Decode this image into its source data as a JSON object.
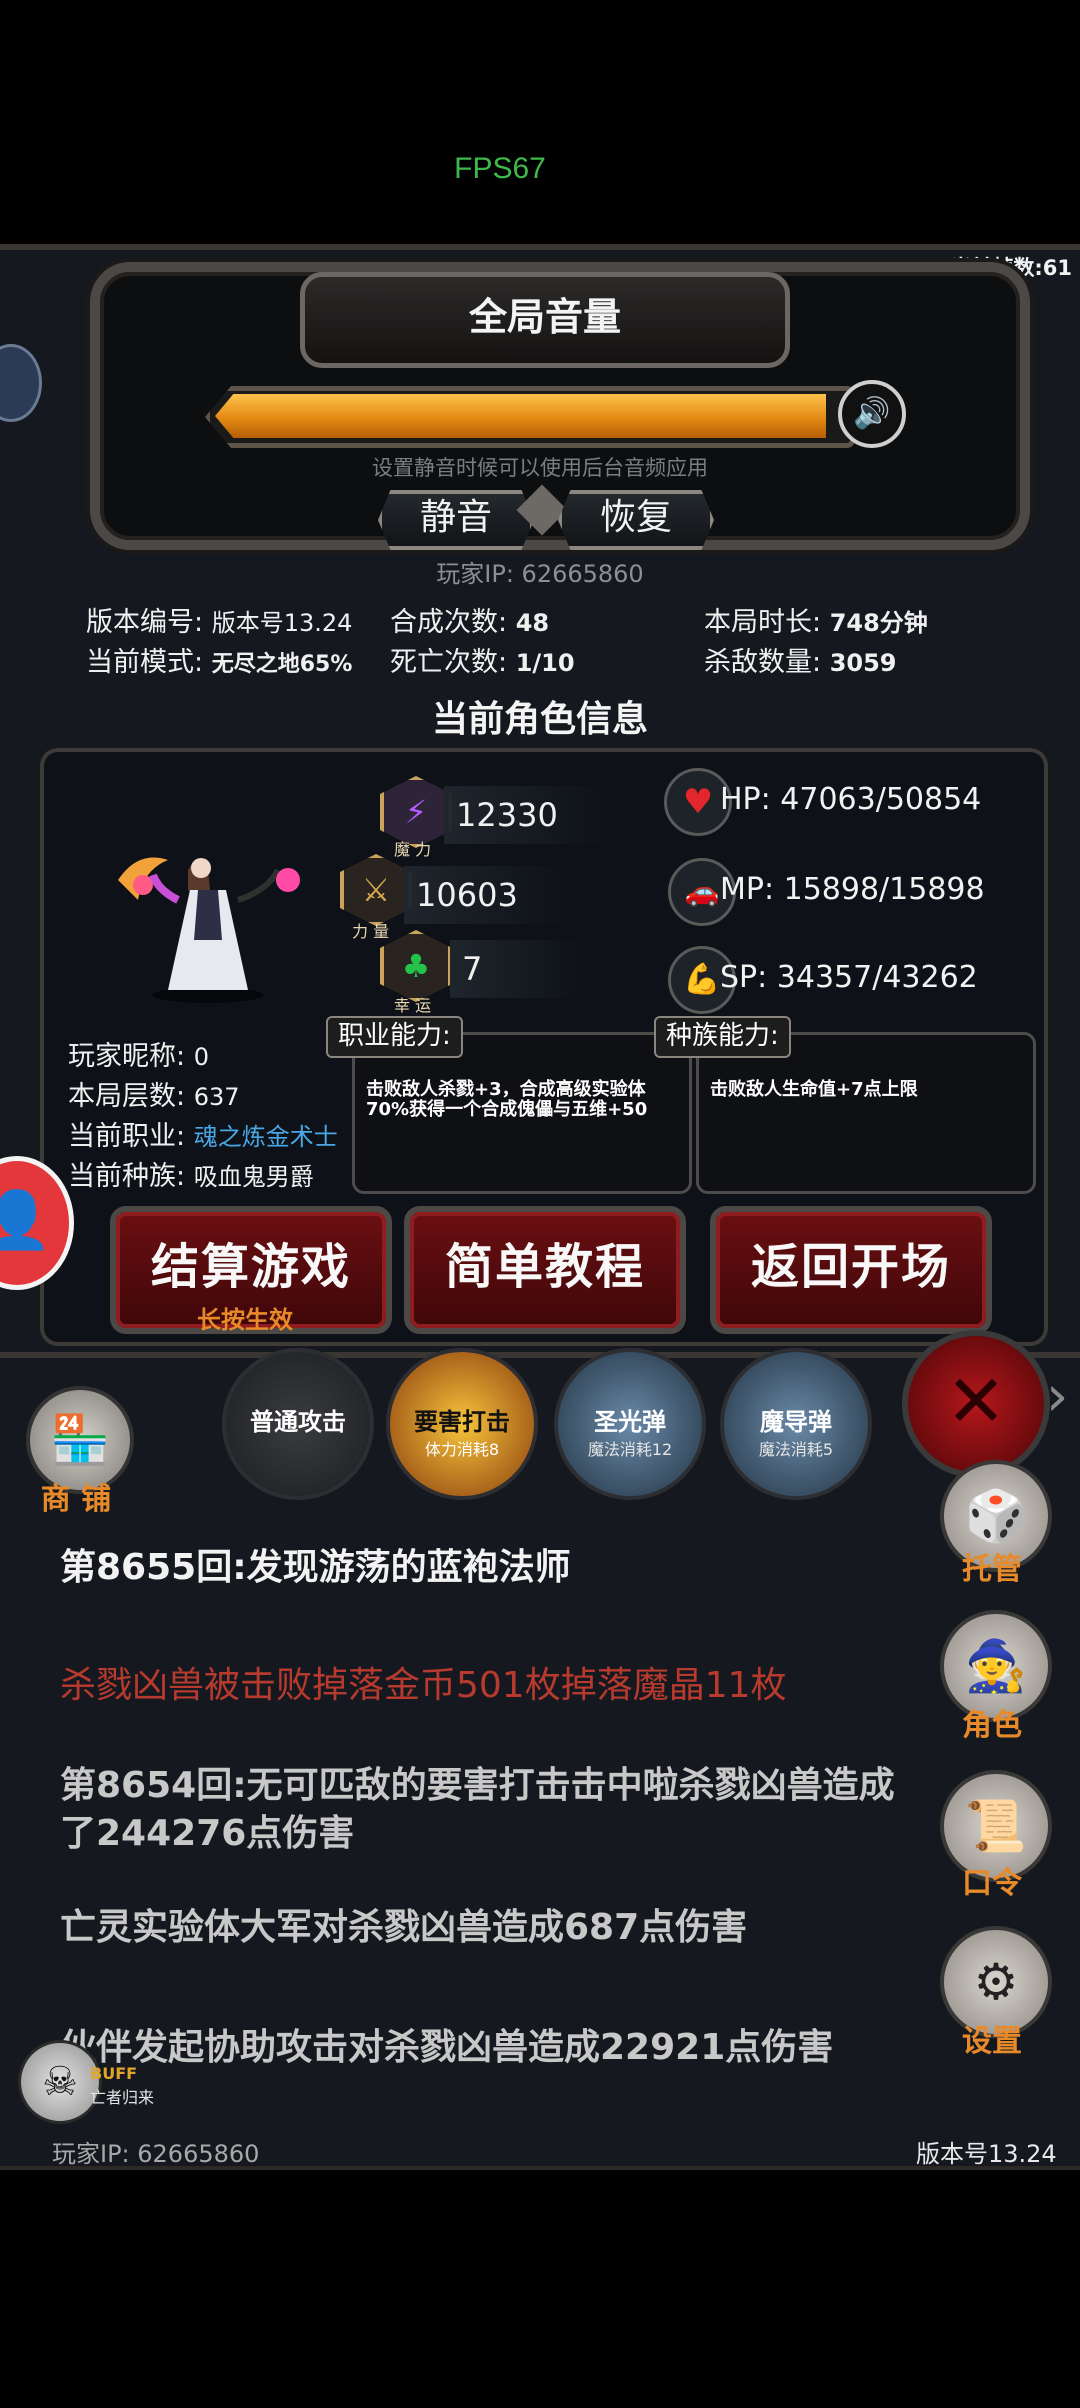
{
  "fps": "FPS67",
  "frame_count": "当前帧数:61",
  "volume": {
    "title": "全局音量",
    "level": 0.97,
    "hint": "设置静音时候可以使用后台音频应用",
    "mute_label": "静音",
    "restore_label": "恢复"
  },
  "player_ip": "玩家IP:  62665860",
  "stats": {
    "version_label": "版本编号:",
    "version_value": "版本号13.24",
    "mode_label": "当前模式:",
    "mode_value": "无尽之地65%",
    "craft_label": "合成次数:",
    "craft_value": "48",
    "death_label": "死亡次数:",
    "death_value": "1/10",
    "duration_label": "本局时长:",
    "duration_value": "748分钟",
    "kills_label": "杀敌数量:",
    "kills_value": "3059"
  },
  "char_section_title": "当前角色信息",
  "attributes": {
    "magic_label": "魔 力",
    "magic_value": "12330",
    "strength_label": "力 量",
    "strength_value": "10603",
    "luck_label": "幸 运",
    "luck_value": "7"
  },
  "resources": {
    "hp": "HP:  47063/50854",
    "mp": "MP:  15898/15898",
    "sp": "SP:  34357/43262"
  },
  "player_info": {
    "nickname_label": "玩家昵称:",
    "nickname_value": "0",
    "floor_label": "本局层数:",
    "floor_value": "637",
    "class_label": "当前职业:",
    "class_value": "魂之炼金术士",
    "race_label": "当前种族:",
    "race_value": "吸血鬼男爵"
  },
  "abilities": {
    "class_title": "职业能力:",
    "class_text": "击败敌人杀戮+3，合成高级实验体70%获得一个合成傀儡与五维+50",
    "race_title": "种族能力:",
    "race_text": "击败敌人生命值+7点上限"
  },
  "buttons": {
    "settle": "结算游戏",
    "settle_sub": "长按生效",
    "tutorial": "简单教程",
    "return": "返回开场"
  },
  "skills": [
    {
      "name": "普通攻击",
      "cost": ""
    },
    {
      "name": "要害打击",
      "cost": "体力消耗8"
    },
    {
      "name": "圣光弹",
      "cost": "魔法消耗12"
    },
    {
      "name": "魔导弹",
      "cost": "魔法消耗5"
    }
  ],
  "shop_label": "商 铺",
  "side_menu": {
    "auto": "托管",
    "character": "角色",
    "command": "口令",
    "settings": "设置"
  },
  "log": [
    "第8655回:发现游荡的蓝袍法师",
    "杀戮凶兽被击败掉落金币501枚掉落魔晶11枚",
    "第8654回:无可匹敌的要害打击击中啦杀戮凶兽造成了244276点伤害",
    "亡灵实验体大军对杀戮凶兽造成687点伤害",
    "伙伴发起协助攻击对杀戮凶兽造成22921点伤害"
  ],
  "buff": {
    "label": "BUFF",
    "name": "亡者归来"
  },
  "footer": {
    "ip": "玩家IP:  62665860",
    "version": "版本号13.24"
  },
  "colors": {
    "log_highlight": "#b83a2e",
    "class_value": "#4aa7e6",
    "accent_orange": "#e88a2a"
  }
}
